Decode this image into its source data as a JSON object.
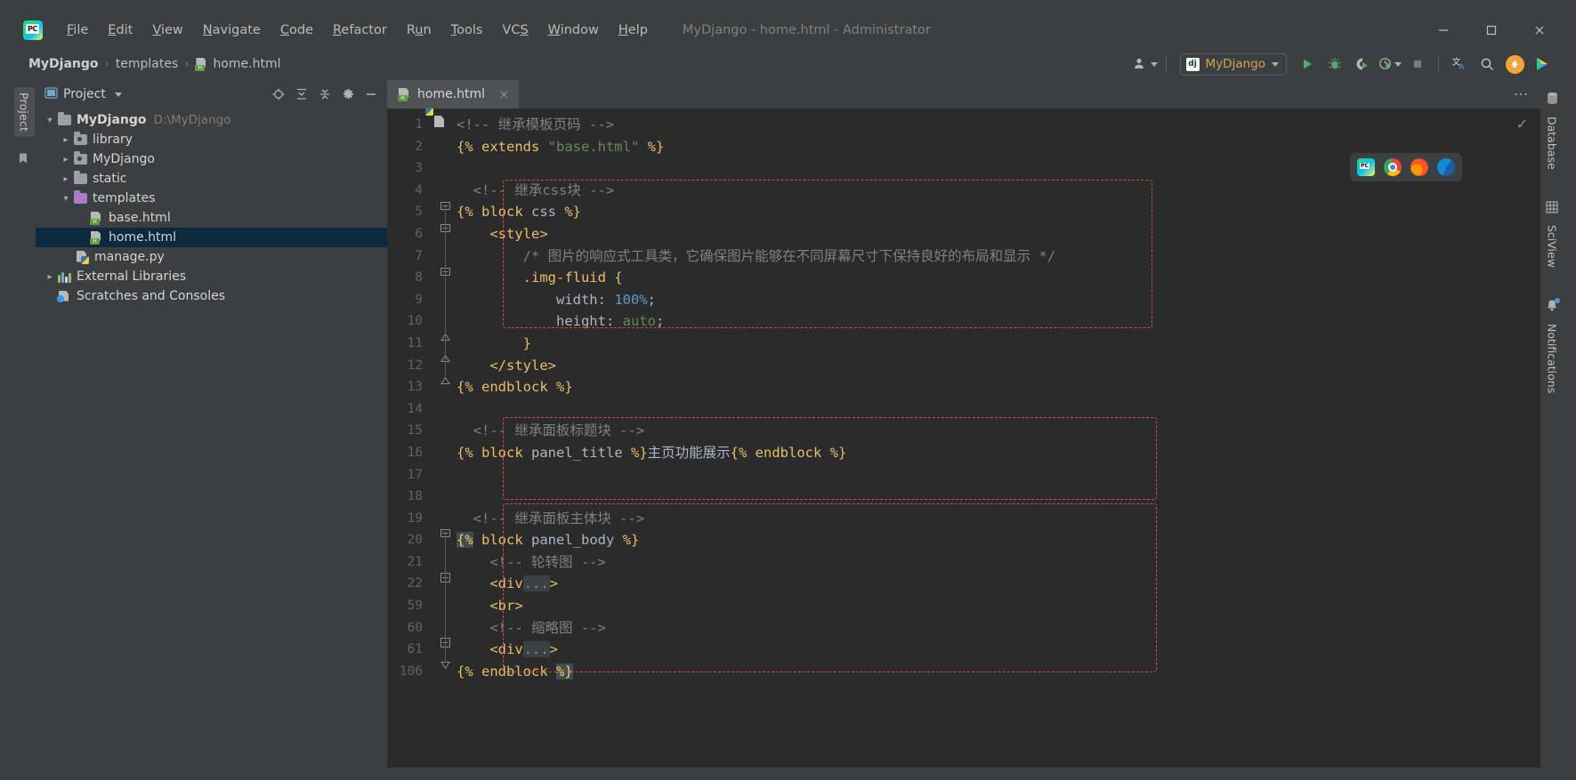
{
  "window": {
    "title": "MyDjango - home.html - Administrator",
    "app_icon": "pycharm-logo-icon",
    "controls": {
      "minimize": "minimize-icon",
      "maximize": "maximize-icon",
      "close": "close-icon"
    }
  },
  "menubar": {
    "items": [
      {
        "label": "File",
        "mnemonic": "F"
      },
      {
        "label": "Edit",
        "mnemonic": "E"
      },
      {
        "label": "View",
        "mnemonic": "V"
      },
      {
        "label": "Navigate",
        "mnemonic": "N"
      },
      {
        "label": "Code",
        "mnemonic": "C"
      },
      {
        "label": "Refactor",
        "mnemonic": "R"
      },
      {
        "label": "Run",
        "mnemonic": "u"
      },
      {
        "label": "Tools",
        "mnemonic": "T"
      },
      {
        "label": "VCS",
        "mnemonic": "S"
      },
      {
        "label": "Window",
        "mnemonic": "W"
      },
      {
        "label": "Help",
        "mnemonic": "H"
      }
    ]
  },
  "navbar": {
    "breadcrumbs": [
      {
        "label": "MyDjango",
        "icon": "",
        "bold": true
      },
      {
        "label": "templates",
        "icon": "",
        "bold": false
      },
      {
        "label": "home.html",
        "icon": "html-file-icon",
        "bold": false
      }
    ],
    "separator": "›",
    "toolbar": {
      "account_icon": "user-account-icon",
      "run_config": {
        "icon": "django-icon",
        "icon_text": "dj",
        "label": "MyDjango"
      },
      "run_icon": "run-icon",
      "debug_icon": "debug-icon",
      "coverage_icon": "run-with-coverage-icon",
      "profile_icon": "profile-icon",
      "stop_icon": "stop-icon",
      "translate_icon": "translate-icon",
      "search_icon": "search-icon",
      "update_icon": "update-arrow-icon",
      "plugin_icon": "plugin-play-icon"
    }
  },
  "left_strip": {
    "tabs": [
      {
        "label": "Project"
      }
    ],
    "bookmark_icon": "bookmarks-icon"
  },
  "project_panel": {
    "header": {
      "icon": "project-view-icon",
      "title": "Project",
      "actions": [
        {
          "name": "select-opened-file-icon"
        },
        {
          "name": "expand-all-icon"
        },
        {
          "name": "collapse-all-icon"
        },
        {
          "name": "settings-gear-icon"
        },
        {
          "name": "hide-panel-icon"
        }
      ]
    },
    "tree": [
      {
        "label": "MyDjango",
        "sub": "D:\\MyDjango",
        "icon": "folder-icon",
        "arrow": "expanded",
        "depth": 0,
        "bold": true,
        "selected": false
      },
      {
        "label": "library",
        "sub": "",
        "icon": "source-folder-icon",
        "arrow": "collapsed",
        "depth": 1,
        "bold": false,
        "selected": false
      },
      {
        "label": "MyDjango",
        "sub": "",
        "icon": "source-folder-icon",
        "arrow": "collapsed",
        "depth": 1,
        "bold": false,
        "selected": false
      },
      {
        "label": "static",
        "sub": "",
        "icon": "folder-icon",
        "arrow": "collapsed",
        "depth": 1,
        "bold": false,
        "selected": false
      },
      {
        "label": "templates",
        "sub": "",
        "icon": "template-folder-icon",
        "arrow": "expanded",
        "depth": 1,
        "bold": false,
        "selected": false
      },
      {
        "label": "base.html",
        "sub": "",
        "icon": "html-file-icon",
        "arrow": "none",
        "depth": 2,
        "bold": false,
        "selected": false
      },
      {
        "label": "home.html",
        "sub": "",
        "icon": "html-file-icon",
        "arrow": "none",
        "depth": 2,
        "bold": false,
        "selected": true
      },
      {
        "label": "manage.py",
        "sub": "",
        "icon": "python-file-icon",
        "arrow": "none",
        "depth": 1,
        "bold": false,
        "selected": false
      },
      {
        "label": "External Libraries",
        "sub": "",
        "icon": "libraries-icon",
        "arrow": "collapsed",
        "depth": 0,
        "bold": false,
        "selected": false
      },
      {
        "label": "Scratches and Consoles",
        "sub": "",
        "icon": "scratches-icon",
        "arrow": "none",
        "depth": 0,
        "bold": false,
        "selected": false
      }
    ]
  },
  "editor": {
    "tabs": [
      {
        "label": "home.html",
        "icon": "html-file-icon",
        "close": "×",
        "active": true
      }
    ],
    "options_icon": "more-options-icon",
    "inspection_status": "✓",
    "browser_popup": {
      "icons": [
        {
          "name": "pycharm-browser-icon"
        },
        {
          "name": "chrome-browser-icon"
        },
        {
          "name": "firefox-browser-icon"
        },
        {
          "name": "edge-browser-icon"
        }
      ]
    },
    "line_numbers": [
      1,
      2,
      3,
      4,
      5,
      6,
      7,
      8,
      9,
      10,
      11,
      12,
      13,
      14,
      15,
      16,
      17,
      18,
      19,
      20,
      21,
      22,
      59,
      60,
      61,
      106
    ],
    "lines": [
      {
        "n": 1,
        "tokens": [
          {
            "t": "<!-- 继承模板页码 -->",
            "c": "c-comment"
          }
        ]
      },
      {
        "n": 2,
        "tokens": [
          {
            "t": "{% ",
            "c": "c-kw"
          },
          {
            "t": "extends ",
            "c": "c-kw"
          },
          {
            "t": "\"base.html\"",
            "c": "c-str"
          },
          {
            "t": " %}",
            "c": "c-kw"
          }
        ]
      },
      {
        "n": 3,
        "tokens": []
      },
      {
        "n": 4,
        "tokens": [
          {
            "t": "  <!-- 继承css块 -->",
            "c": "c-comment"
          }
        ]
      },
      {
        "n": 5,
        "tokens": [
          {
            "t": "{% ",
            "c": "c-kw"
          },
          {
            "t": "block ",
            "c": "c-kw"
          },
          {
            "t": "css",
            "c": "c-text"
          },
          {
            "t": " %}",
            "c": "c-kw"
          }
        ]
      },
      {
        "n": 6,
        "tokens": [
          {
            "t": "    <style>",
            "c": "c-tag"
          }
        ]
      },
      {
        "n": 7,
        "tokens": [
          {
            "t": "        /* 图片的响应式工具类，它确保图片能够在不同屏幕尺寸下保持良好的布局和显示 */",
            "c": "c-comment"
          }
        ]
      },
      {
        "n": 8,
        "tokens": [
          {
            "t": "        .img-fluid {",
            "c": "c-tag"
          }
        ]
      },
      {
        "n": 9,
        "tokens": [
          {
            "t": "            width",
            "c": "c-text"
          },
          {
            "t": ": ",
            "c": "c-plain"
          },
          {
            "t": "100%",
            "c": "c-num"
          },
          {
            "t": ";",
            "c": "c-plain"
          }
        ]
      },
      {
        "n": 10,
        "tokens": [
          {
            "t": "            height",
            "c": "c-text"
          },
          {
            "t": ": ",
            "c": "c-plain"
          },
          {
            "t": "auto",
            "c": "c-val"
          },
          {
            "t": ";",
            "c": "c-plain"
          }
        ]
      },
      {
        "n": 11,
        "tokens": [
          {
            "t": "        }",
            "c": "c-tag"
          }
        ]
      },
      {
        "n": 12,
        "tokens": [
          {
            "t": "    </style>",
            "c": "c-tag"
          }
        ]
      },
      {
        "n": 13,
        "tokens": [
          {
            "t": "{% ",
            "c": "c-kw"
          },
          {
            "t": "endblock ",
            "c": "c-kw"
          },
          {
            "t": "%}",
            "c": "c-kw"
          }
        ]
      },
      {
        "n": 14,
        "tokens": []
      },
      {
        "n": 15,
        "tokens": [
          {
            "t": "  <!-- 继承面板标题块 -->",
            "c": "c-comment"
          }
        ]
      },
      {
        "n": 16,
        "tokens": [
          {
            "t": "{% ",
            "c": "c-kw"
          },
          {
            "t": "block ",
            "c": "c-kw"
          },
          {
            "t": "panel_title",
            "c": "c-text"
          },
          {
            "t": " %}",
            "c": "c-kw"
          },
          {
            "t": "主页功能展示",
            "c": "c-plain"
          },
          {
            "t": "{% ",
            "c": "c-kw"
          },
          {
            "t": "endblock ",
            "c": "c-kw"
          },
          {
            "t": "%}",
            "c": "c-kw"
          }
        ]
      },
      {
        "n": 17,
        "tokens": []
      },
      {
        "n": 18,
        "tokens": []
      },
      {
        "n": 19,
        "tokens": [
          {
            "t": "  <!-- 继承面板主体块 -->",
            "c": "c-comment"
          }
        ]
      },
      {
        "n": 20,
        "tokens": [
          {
            "t": "{%",
            "c": "hl-brace"
          },
          {
            "t": " ",
            "c": "c-kw"
          },
          {
            "t": "block ",
            "c": "c-kw"
          },
          {
            "t": "panel_body",
            "c": "c-text"
          },
          {
            "t": " %}",
            "c": "c-kw"
          }
        ]
      },
      {
        "n": 21,
        "tokens": [
          {
            "t": "    <!-- 轮转图 -->",
            "c": "c-comment"
          }
        ]
      },
      {
        "n": 22,
        "tokens": [
          {
            "t": "    <div",
            "c": "c-tag"
          },
          {
            "t": "...",
            "c": "fold-ellipsis"
          },
          {
            "t": ">",
            "c": "c-tag"
          }
        ]
      },
      {
        "n": 59,
        "tokens": [
          {
            "t": "    <br>",
            "c": "c-tag"
          }
        ]
      },
      {
        "n": 60,
        "tokens": [
          {
            "t": "    <!-- 缩略图 -->",
            "c": "c-comment"
          }
        ]
      },
      {
        "n": 61,
        "tokens": [
          {
            "t": "    <div",
            "c": "c-tag"
          },
          {
            "t": "...",
            "c": "fold-ellipsis"
          },
          {
            "t": ">",
            "c": "c-tag"
          }
        ]
      },
      {
        "n": 106,
        "tokens": [
          {
            "t": "{% ",
            "c": "c-kw"
          },
          {
            "t": "endblock ",
            "c": "c-kw"
          },
          {
            "t": "%}",
            "c": "hl-brace"
          }
        ]
      }
    ]
  },
  "right_strip": {
    "tabs": [
      {
        "label": "Database",
        "icon": "database-icon"
      },
      {
        "label": "SciView",
        "icon": "sciview-icon"
      },
      {
        "label": "Notifications",
        "icon": "notifications-bell-icon"
      }
    ]
  },
  "colors": {
    "accent_green": "#59a869",
    "warn_orange": "#f2a33c",
    "selection_blue": "#0d293e",
    "injection_red": "#d64b4b",
    "panel_bg": "#3c3f41",
    "editor_bg": "#2b2b2b"
  }
}
